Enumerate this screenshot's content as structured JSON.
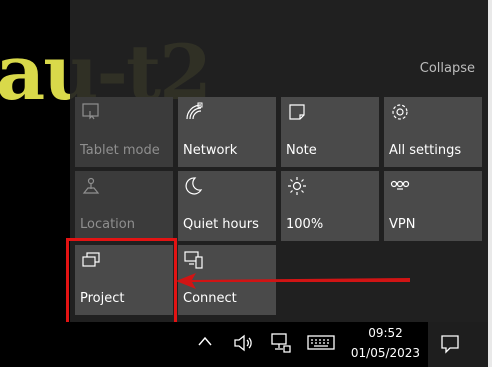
{
  "wallpaper": {
    "text": "au-t2"
  },
  "action_center": {
    "collapse_label": "Collapse",
    "tiles": [
      {
        "label": "Tablet mode",
        "icon": "tablet-mode-icon",
        "enabled": false
      },
      {
        "label": "Network",
        "icon": "network-icon",
        "enabled": true
      },
      {
        "label": "Note",
        "icon": "note-icon",
        "enabled": true
      },
      {
        "label": "All settings",
        "icon": "gear-icon",
        "enabled": true
      },
      {
        "label": "Location",
        "icon": "location-icon",
        "enabled": false
      },
      {
        "label": "Quiet hours",
        "icon": "moon-icon",
        "enabled": true
      },
      {
        "label": "100%",
        "icon": "brightness-icon",
        "enabled": true
      },
      {
        "label": "VPN",
        "icon": "vpn-icon",
        "enabled": true
      },
      {
        "label": "Project",
        "icon": "project-icon",
        "enabled": true
      },
      {
        "label": "Connect",
        "icon": "connect-icon",
        "enabled": true
      }
    ]
  },
  "annotation": {
    "highlight_color": "#e21313",
    "arrow_color": "#d11414"
  },
  "taskbar": {
    "tray_icons": [
      "chevron-up-icon",
      "speaker-icon",
      "network-wired-icon",
      "keyboard-icon"
    ],
    "time": "09:52",
    "date": "01/05/2023",
    "notification_icon": "notification-icon"
  }
}
